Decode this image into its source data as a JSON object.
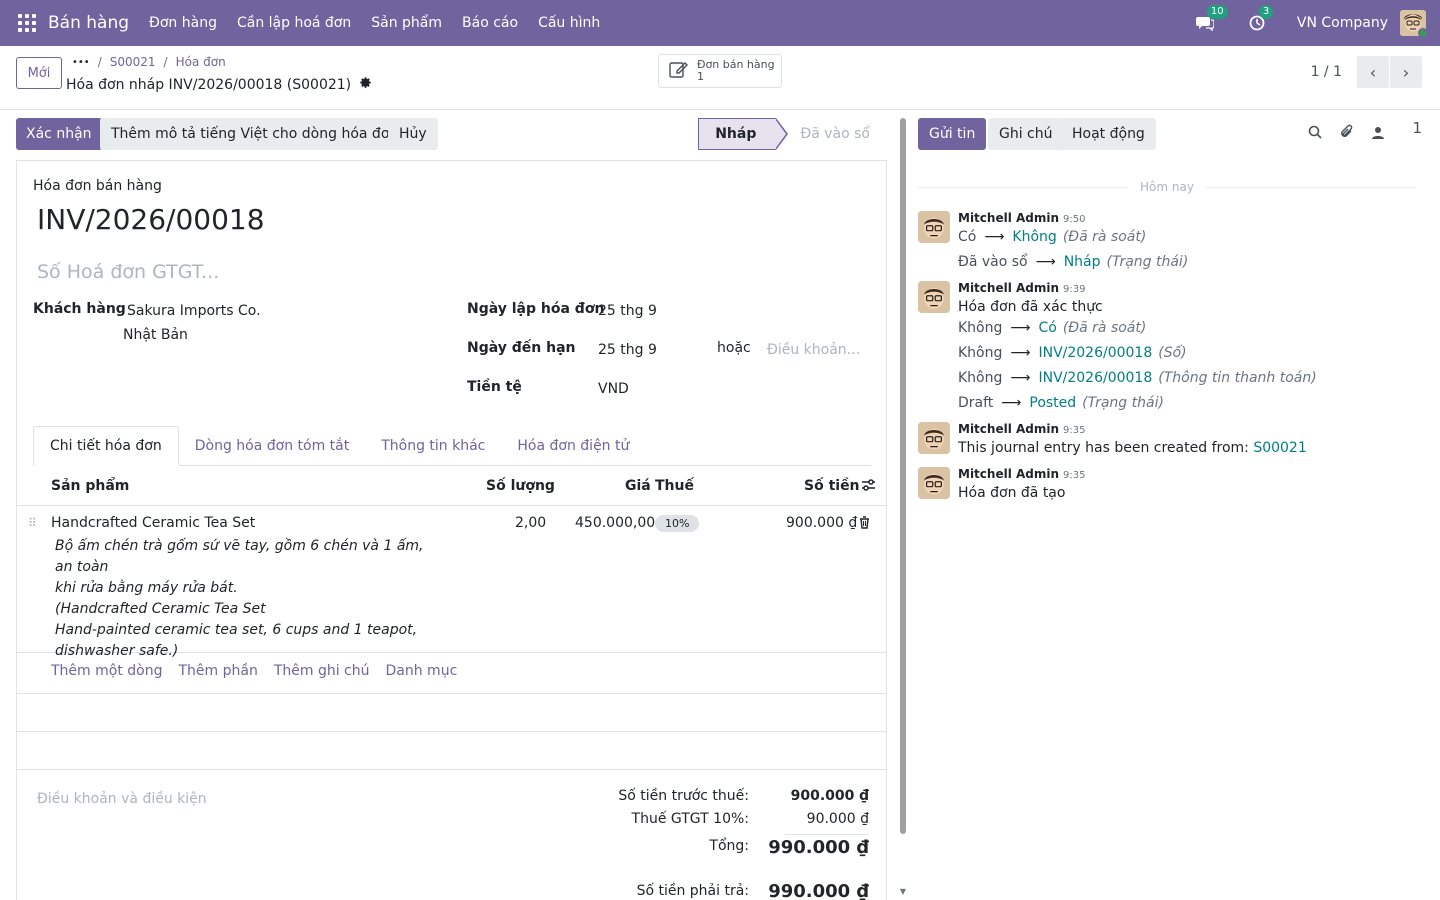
{
  "navbar": {
    "app_name": "Bán hàng",
    "menu": [
      "Đơn hàng",
      "Cần lập hoá đơn",
      "Sản phẩm",
      "Báo cáo",
      "Cấu hình"
    ],
    "messages_count": "10",
    "activities_count": "3",
    "company": "VN Company"
  },
  "control": {
    "new_label": "Mới",
    "breadcrumb_more": "•••",
    "breadcrumb": [
      "S00021",
      "Hóa đơn"
    ],
    "title": "Hóa đơn nháp INV/2026/00018 (S00021)",
    "smart_button_label": "Đơn bán hàng",
    "smart_button_count": "1",
    "pager": "1 / 1"
  },
  "statusbar": {
    "confirm": "Xác nhận",
    "add_desc": "Thêm mô tả tiếng Việt cho dòng hóa đơn",
    "cancel": "Hủy",
    "steps": [
      "Nháp",
      "Đã vào sổ"
    ]
  },
  "invoice": {
    "doc_type": "Hóa đơn bán hàng",
    "name": "INV/2026/00018",
    "vat_placeholder": "Số Hoá đơn GTGT...",
    "customer_label": "Khách hàng",
    "customer_name": "Sakura Imports Co.",
    "customer_country": "Nhật Bản",
    "invoice_date_label": "Ngày lập hóa đơn",
    "invoice_date": "25 thg 9",
    "due_date_label": "Ngày đến hạn",
    "due_date": "25 thg 9",
    "or_label": "hoặc",
    "terms_placeholder": "Điều khoản...",
    "currency_label": "Tiền tệ",
    "currency": "VND"
  },
  "tabs": [
    "Chi tiết hóa đơn",
    "Dòng hóa đơn tóm tắt",
    "Thông tin khác",
    "Hóa đơn điện tử"
  ],
  "lines": {
    "headers": {
      "product": "Sản phẩm",
      "qty": "Số lượng",
      "price": "Giá",
      "tax": "Thuế",
      "amount": "Số tiền"
    },
    "rows": [
      {
        "product": "Handcrafted Ceramic Tea Set",
        "desc": [
          "Bộ ấm chén trà gốm sứ vẽ tay, gồm 6 chén và 1 ấm, an toàn",
          "khi rửa bằng máy rửa bát.",
          "(Handcrafted Ceramic Tea Set",
          "Hand-painted ceramic tea set, 6 cups and 1 teapot,",
          "dishwasher safe.)"
        ],
        "qty": "2,00",
        "price": "450.000,00",
        "tax": "10%",
        "amount": "900.000 ₫"
      }
    ],
    "add_links": [
      "Thêm một dòng",
      "Thêm phần",
      "Thêm ghi chú",
      "Danh mục"
    ]
  },
  "footer": {
    "terms_placeholder": "Điều khoản và điều kiện",
    "untaxed_label": "Số tiền trước thuế:",
    "untaxed": "900.000 ₫",
    "vat_label": "Thuế GTGT 10%:",
    "vat": "90.000 ₫",
    "total_label": "Tổng:",
    "total": "990.000 ₫",
    "due_label": "Số tiền phải trả:",
    "due": "990.000 ₫"
  },
  "chatter": {
    "send_message": "Gửi tin",
    "log_note": "Ghi chú",
    "activity": "Hoạt động",
    "followers_count": "1",
    "today": "Hôm nay",
    "messages": [
      {
        "author": "Mitchell Admin",
        "time": "9:50"
      },
      {
        "author": "Mitchell Admin",
        "time": "9:39",
        "body": "Hóa đơn đã xác thực"
      },
      {
        "author": "Mitchell Admin",
        "time": "9:35",
        "body": "This journal entry has been created from:",
        "link": "S00021"
      },
      {
        "author": "Mitchell Admin",
        "time": "9:35",
        "body": "Hóa đơn đã tạo"
      }
    ],
    "changes_1": [
      {
        "old": "Có",
        "new": "Không",
        "field": "(Đã rà soát)"
      },
      {
        "old": "Đã vào sổ",
        "new": "Nháp",
        "field": "(Trạng thái)"
      }
    ],
    "changes_2": [
      {
        "old": "Không",
        "new": "Có",
        "field": "(Đã rà soát)"
      },
      {
        "old": "Không",
        "new": "INV/2026/00018",
        "field": "(Số)"
      },
      {
        "old": "Không",
        "new": "INV/2026/00018",
        "field": "(Thông tin thanh toán)"
      },
      {
        "old": "Draft",
        "new": "Posted",
        "field": "(Trạng thái)"
      }
    ]
  },
  "colors": {
    "brand": "#71639e",
    "link": "#017e84",
    "badge": "#21a080"
  }
}
